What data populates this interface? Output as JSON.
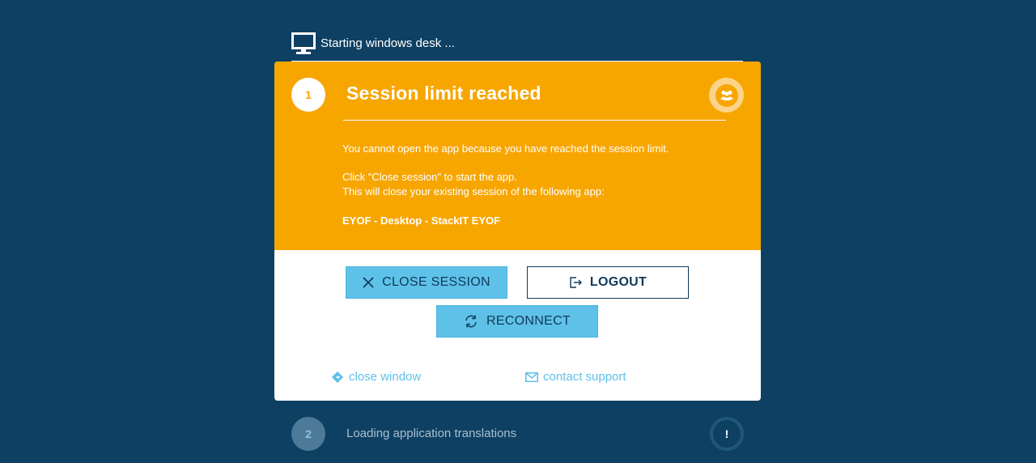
{
  "topbar": {
    "icon": "monitor-icon",
    "title": "Starting windows desk ..."
  },
  "dialog": {
    "step_number": "1",
    "title": "Session limit reached",
    "badge_icon": "people-icon",
    "message_1": "You cannot open the app because you have reached the session limit.",
    "message_2": "Click \"Close session\" to start the app.",
    "message_3": "This will close your existing session of the following app:",
    "app_name": "EYOF - Desktop - StackIT EYOF",
    "buttons": {
      "close_session": "CLOSE SESSION",
      "logout": "LOGOUT",
      "reconnect": "RECONNECT"
    },
    "links": {
      "close_window": "close window",
      "contact_support": "contact support"
    }
  },
  "step2": {
    "number": "2",
    "label": "Loading application translations",
    "status_icon": "!"
  },
  "colors": {
    "background": "#0e4063",
    "warning": "#f7a600",
    "accent": "#5ec1e8",
    "text_dark": "#0e3a5a"
  }
}
